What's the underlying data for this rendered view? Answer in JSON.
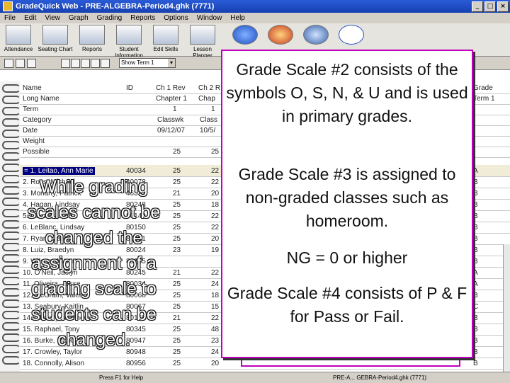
{
  "window": {
    "title": "GradeQuick Web - PRE-ALGEBRA-Period4.ghk (7771)",
    "buttons": [
      "_",
      "□",
      "×"
    ]
  },
  "menu": [
    "File",
    "Edit",
    "View",
    "Graph",
    "Grading",
    "Reports",
    "Options",
    "Window",
    "Help"
  ],
  "toolbar": [
    {
      "label": "Attendance",
      "icon": "calendar-icon"
    },
    {
      "label": "Seating Chart",
      "icon": "seating-chart-icon"
    },
    {
      "label": "Reports",
      "icon": "reports-icon"
    },
    {
      "label": "Student Information",
      "icon": "student-info-icon"
    },
    {
      "label": "Edit Skills",
      "icon": "edit-skills-icon"
    },
    {
      "label": "Lesson Planner",
      "icon": "lesson-planner-icon"
    }
  ],
  "term_select": "Show Term 1",
  "header_rows": [
    {
      "label": "Name",
      "id": "ID",
      "c1": "Ch 1 Rev",
      "c2": "Ch 2 R",
      "grade": "Grade"
    },
    {
      "label": "Long Name",
      "id": "",
      "c1": "Chapter 1",
      "c2": "Chap",
      "grade": "Term 1"
    },
    {
      "label": "Term",
      "id": "",
      "c1": "1",
      "c2": "1",
      "grade": ""
    },
    {
      "label": "Category",
      "id": "",
      "c1": "Classwk",
      "c2": "Class",
      "grade": ""
    },
    {
      "label": "Date",
      "id": "",
      "c1": "09/12/07",
      "c2": "10/5/",
      "grade": ""
    },
    {
      "label": "Weight",
      "id": "",
      "c1": "",
      "c2": "",
      "grade": ""
    },
    {
      "label": "Possible",
      "id": "",
      "c1": "25",
      "c2": "25",
      "grade": ""
    }
  ],
  "students": [
    {
      "name": "= 1. Leitao, Ann Marie",
      "id": "40034",
      "s1": "25",
      "s2": "22",
      "grade": "A"
    },
    {
      "name": "2. Ross, Michael",
      "id": "40078",
      "s1": "25",
      "s2": "22",
      "grade": "B"
    },
    {
      "name": "3. Moriarty, Patrick",
      "id": "46335",
      "s1": "21",
      "s2": "20",
      "grade": "B"
    },
    {
      "name": "4. Hagan, Lindsay",
      "id": "80248",
      "s1": "25",
      "s2": "18",
      "grade": "B"
    },
    {
      "name": "5. Liberati, Josh",
      "id": "80149",
      "s1": "25",
      "s2": "22",
      "grade": "B"
    },
    {
      "name": "6. LeBlanc, Lindsay",
      "id": "80150",
      "s1": "25",
      "s2": "22",
      "grade": "B"
    },
    {
      "name": "7. Ryan, Mariah",
      "id": "80151",
      "s1": "25",
      "s2": "20",
      "grade": "B"
    },
    {
      "name": "8. Luiz, Braedyn",
      "id": "80024",
      "s1": "23",
      "s2": "19",
      "grade": "B"
    },
    {
      "name": "9. Wilson, Allison",
      "id": "80155",
      "s1": "",
      "s2": "",
      "grade": "B"
    },
    {
      "name": "10. O'Neil, Jaclyn",
      "id": "80245",
      "s1": "21",
      "s2": "22",
      "grade": "A"
    },
    {
      "name": "11. Oliveira, Jesse",
      "id": "80034",
      "s1": "25",
      "s2": "24",
      "grade": "A"
    },
    {
      "name": "12. McGrath, Valerie",
      "id": "80068",
      "s1": "25",
      "s2": "18",
      "grade": "B"
    },
    {
      "name": "13. Seabury, Kaitlin",
      "id": "80067",
      "s1": "25",
      "s2": "15",
      "grade": "C"
    },
    {
      "name": "14. Clohery, Matthew",
      "id": "80150",
      "s1": "21",
      "s2": "22",
      "grade": "B"
    },
    {
      "name": "15. Raphael, Tony",
      "id": "80345",
      "s1": "25",
      "s2": "48",
      "grade": "B"
    },
    {
      "name": "16. Burke, Mark",
      "id": "80947",
      "s1": "25",
      "s2": "23",
      "grade": "B"
    },
    {
      "name": "17. Crowley, Taylor",
      "id": "80948",
      "s1": "25",
      "s2": "24",
      "grade": "B"
    },
    {
      "name": "18. Connolly, Alison",
      "id": "80956",
      "s1": "25",
      "s2": "20",
      "grade": "B"
    }
  ],
  "status": {
    "left": "Press F1 for Help",
    "right": "PRE-A... GEBRA-Period4.ghk (7771)"
  },
  "callout": {
    "p1": "Grade Scale #2 consists of the symbols O, S, N, & U and is used in primary grades.",
    "p2": "Grade Scale  #3 is assigned to non-graded classes such as homeroom.",
    "p3": "NG = 0 or higher",
    "p4": "Grade Scale #4 consists of P & F for Pass or Fail."
  },
  "overlay": {
    "text": "While grading scales cannot be changed the assignment of a grading scale to students can be changed."
  },
  "colors": {
    "callout_border": "#c000c0",
    "titlebar": "#1f4fc4"
  }
}
